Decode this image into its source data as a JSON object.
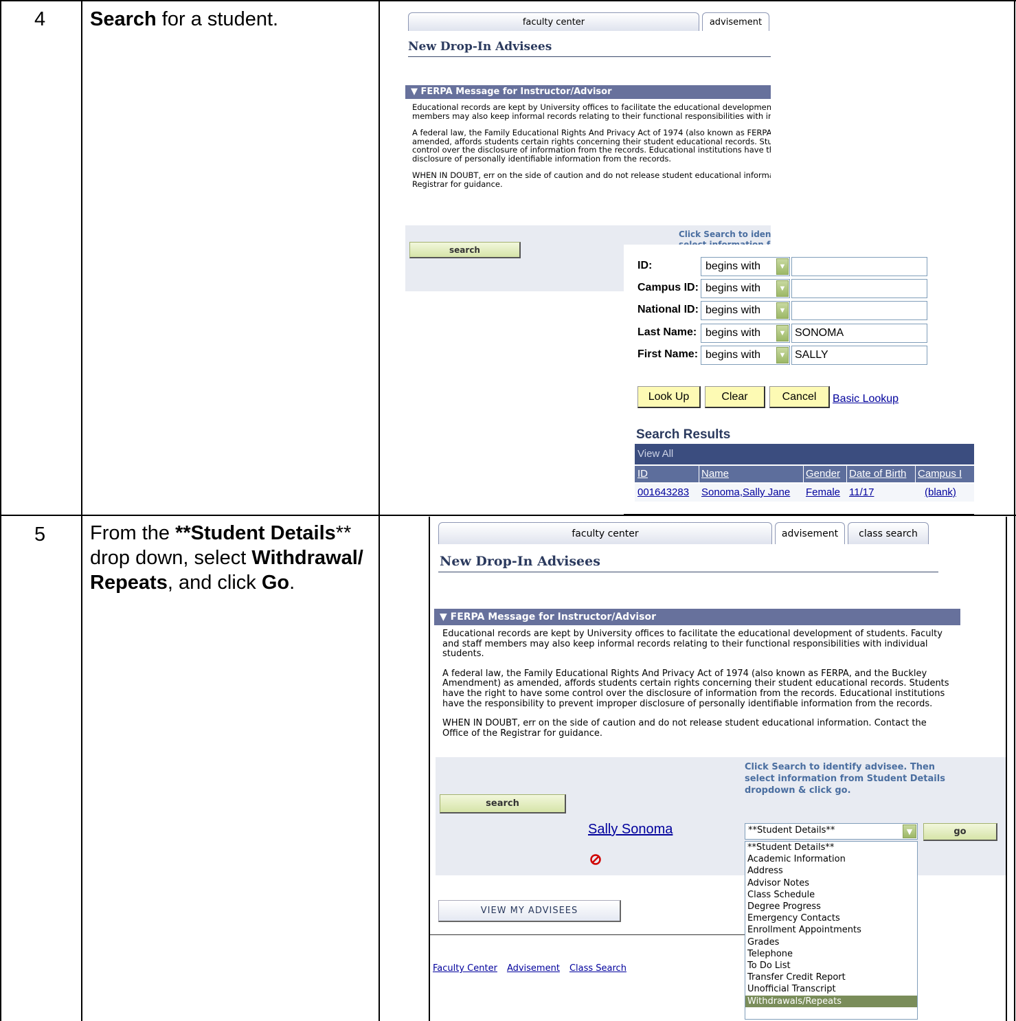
{
  "steps": [
    {
      "number": "4",
      "instruction": {
        "part1_bold": "Search",
        "part2": " for a student."
      }
    },
    {
      "number": "5",
      "instruction": {
        "part1": "From the ",
        "part2_bold": "**Student Details",
        "part3": "** drop down, select ",
        "part4_bold": "Withdrawal/ Repeats",
        "part5": ", and click ",
        "part6_bold": "Go",
        "part7": "."
      }
    }
  ],
  "ps": {
    "tabs": {
      "faculty_center": "faculty center",
      "advisement": "advisement",
      "class_search": "class search"
    },
    "page_title": "New Drop-In Advisees",
    "ferpa_header": "▼ FERPA Message for Instructor/Advisor",
    "ferpa_p1": "Educational records are kept by University offices to facilitate the educational development of students. Faculty and staff members may also keep informal records relating to their functional responsibilities with individual students.",
    "ferpa_p2": "A federal law, the Family Educational Rights And Privacy Act of 1974 (also known as FERPA, and the Buckley Amendment) as amended, affords students certain rights concerning their student educational records. Students have the right to have some control over the disclosure of information from the records. Educational institutions have the responsibility to prevent improper disclosure of personally identifiable information from the records.",
    "ferpa_p3": "WHEN IN DOUBT, err on the side of caution and do not release student educational information. Contact the Office of the Registrar for guidance.",
    "search_button": "search",
    "hint_short": "Click Search to iden",
    "hint_short2": "select information f",
    "hint_full": "Click Search to identify advisee. Then select information from Student Details dropdown & click go."
  },
  "lookup": {
    "fields": [
      {
        "label": "ID:",
        "operator": "begins with",
        "value": ""
      },
      {
        "label": "Campus ID:",
        "operator": "begins with",
        "value": ""
      },
      {
        "label": "National ID:",
        "operator": "begins with",
        "value": ""
      },
      {
        "label": "Last Name:",
        "operator": "begins with",
        "value": "SONOMA"
      },
      {
        "label": "First Name:",
        "operator": "begins with",
        "value": "SALLY"
      }
    ],
    "buttons": {
      "look_up": "Look Up",
      "clear": "Clear",
      "cancel": "Cancel",
      "basic_lookup": "Basic Lookup"
    },
    "results_title": "Search Results",
    "view_all": "View All",
    "columns": [
      "ID",
      "Name",
      "Gender",
      "Date of Birth",
      "Campus I"
    ],
    "row": [
      "001643283",
      "Sonoma,Sally Jane",
      "Female",
      "11/17",
      "(blank)"
    ]
  },
  "advisee": {
    "student_name": "Sally Sonoma",
    "student_details_selected": "**Student Details**",
    "go_button": "go",
    "dropdown_options": [
      "**Student Details**",
      "Academic Information",
      "Address",
      "Advisor Notes",
      "Class Schedule",
      "Degree Progress",
      "Emergency Contacts",
      "Enrollment Appointments",
      "Grades",
      "Telephone",
      "To Do List",
      "Transfer Credit Report",
      "Unofficial Transcript",
      "Withdrawals/Repeats"
    ],
    "highlighted_option": "Withdrawals/Repeats",
    "view_my_advisees": "VIEW MY ADVISEES",
    "footer_links": [
      "Faculty Center",
      "Advisement",
      "Class Search"
    ]
  },
  "colors": {
    "ferpa_bar": "#67719c",
    "results_bar": "#3b4d7f",
    "highlight": "#7a8d5a",
    "no_icon": "#d00000"
  }
}
